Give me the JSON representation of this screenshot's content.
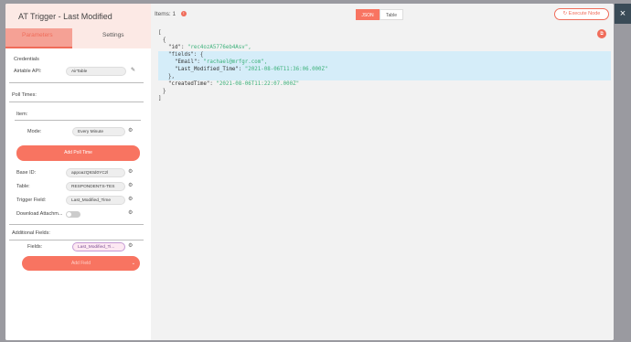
{
  "title": "AT Trigger - Last Modified",
  "tabs": {
    "parameters": "Parameters",
    "settings": "Settings"
  },
  "credentials": {
    "section": "Credentials",
    "label": "Airtable API:",
    "value": "AirTable"
  },
  "pollTimes": {
    "section": "Poll Times:",
    "item": "Item:",
    "modeLabel": "Mode:",
    "modeValue": "Every Minute",
    "addButton": "Add Poll Time"
  },
  "fields": {
    "baseId": {
      "label": "Base ID:",
      "value": "appoazQ93d0YCzl"
    },
    "table": {
      "label": "Table:",
      "value": "RESPONDENTS-TES"
    },
    "triggerField": {
      "label": "Trigger Field:",
      "value": "Last_Modified_Time"
    },
    "downloadAttachments": {
      "label": "Download Attachm..."
    }
  },
  "additionalFields": {
    "section": "Additional Fields:",
    "fieldsLabel": "Fields:",
    "fieldsValue": "Last_Modified_Ti...",
    "addButton": "Add Field"
  },
  "output": {
    "itemsLabel": "Items: 1",
    "badge": "!",
    "view": {
      "json": "JSON",
      "table": "Table"
    },
    "executeButton": "Execute Node",
    "json": {
      "open": "[",
      "objOpen": "{",
      "idKey": "\"id\": ",
      "idVal": "\"rec4ozA5776eb4Asv\",",
      "fieldsKey": "\"fields\": {",
      "emailKey": "\"Email\": ",
      "emailVal": "\"rachael@mrfgr.com\",",
      "lmtKey": "\"Last_Modified_Time\": ",
      "lmtVal": "\"2021-08-06T11:36:06.000Z\"",
      "fieldsClose": "},",
      "createdKey": "\"createdTime\": ",
      "createdVal": "\"2021-08-06T11:22:07.000Z\"",
      "objClose": "}",
      "close": "]"
    }
  },
  "colors": {
    "accent": "#f06c5a",
    "highlight": "#d5edf9",
    "string": "#3cb17a"
  }
}
